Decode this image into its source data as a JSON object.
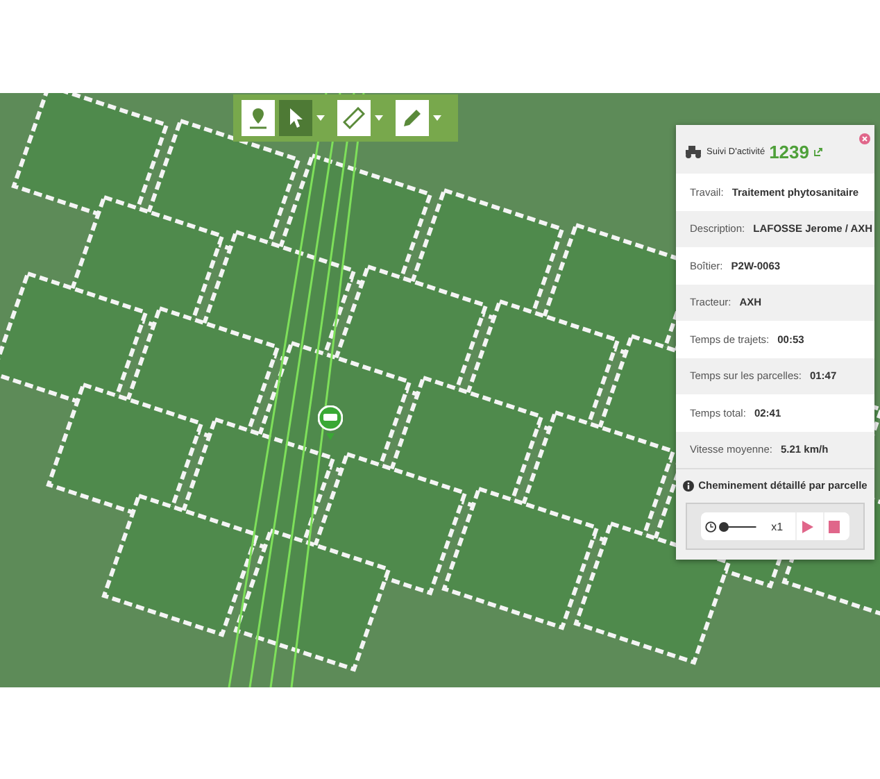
{
  "toolbar": [
    {
      "kind": "map-pin",
      "selected": false,
      "dropdown": false
    },
    {
      "kind": "pointer",
      "selected": true,
      "dropdown": true
    },
    {
      "kind": "ruler",
      "selected": false,
      "dropdown": true
    },
    {
      "kind": "pencil",
      "selected": false,
      "dropdown": true
    }
  ],
  "panel": {
    "title": "Suivi D'activité",
    "number": "1239",
    "rows": [
      {
        "label": "Travail:",
        "value": "Traitement phytosanitaire"
      },
      {
        "label": "Description:",
        "value": "LAFOSSE Jerome / AXH"
      },
      {
        "label": "Boîtier:",
        "value": "P2W-0063"
      },
      {
        "label": "Tracteur:",
        "value": "AXH"
      },
      {
        "label": "Temps de trajets:",
        "value": "00:53"
      },
      {
        "label": "Temps sur les parcelles:",
        "value": "01:47"
      },
      {
        "label": "Temps total:",
        "value": "02:41"
      },
      {
        "label": "Vitesse moyenne:",
        "value": "5.21 km/h"
      }
    ],
    "section": "Cheminement détaillé par parcelle",
    "player": {
      "level": 0,
      "speed": "x1"
    }
  }
}
